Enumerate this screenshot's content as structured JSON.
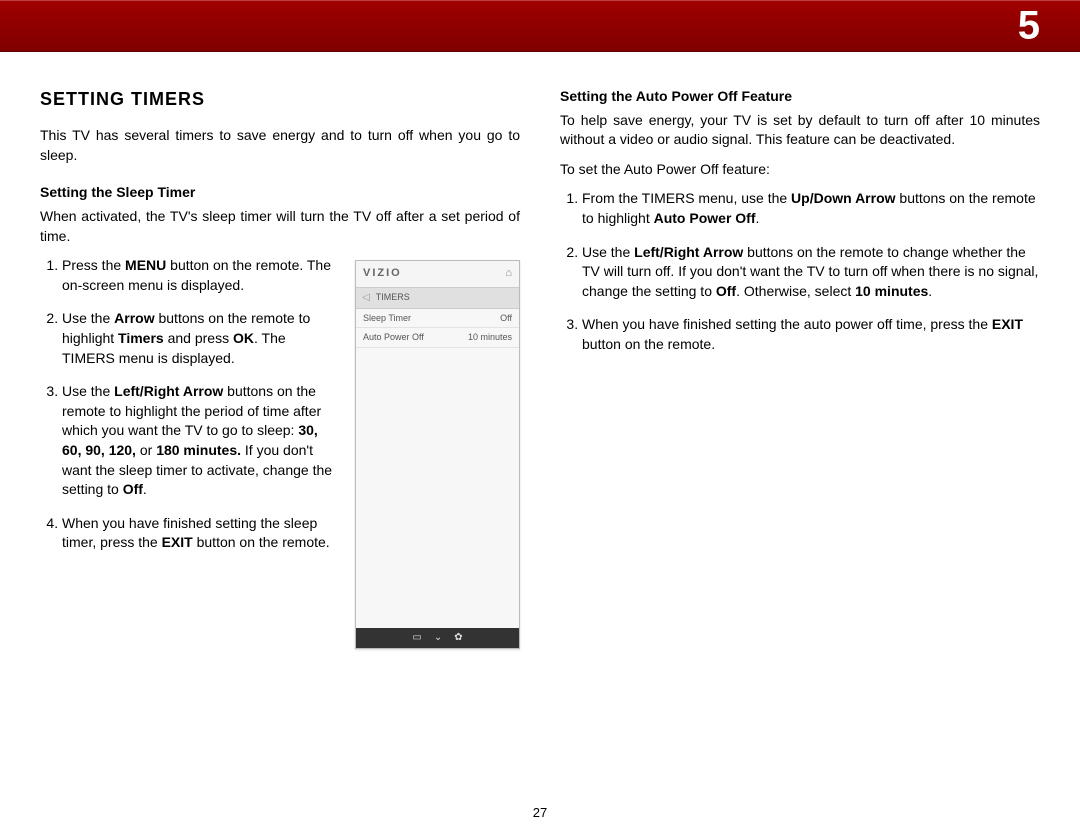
{
  "chapter": "5",
  "page_number": "27",
  "left": {
    "title": "SETTING TIMERS",
    "intro": "This TV has several timers to save energy and to turn off when you go to sleep.",
    "sleep_heading": "Setting the Sleep Timer",
    "sleep_intro": "When activated, the TV's sleep timer will turn the TV off after a set period of time.",
    "steps": {
      "s1a": "Press the ",
      "s1b": "MENU",
      "s1c": " button on the remote. The on-screen menu is displayed.",
      "s2a": "Use the ",
      "s2b": "Arrow",
      "s2c": " buttons on the remote to highlight ",
      "s2d": "Timers",
      "s2e": " and press ",
      "s2f": "OK",
      "s2g": ". The TIMERS menu is displayed.",
      "s3a": "Use the ",
      "s3b": "Left/Right Arrow",
      "s3c": " buttons on the remote to highlight the period of time after which you want the TV to go to sleep: ",
      "s3d": "30, 60, 90, 120,",
      "s3e": " or ",
      "s3f": "180 minutes.",
      "s3g": " If you don't want the sleep timer to activate, change the setting to ",
      "s3h": "Off",
      "s3i": ".",
      "s4a": "When you have finished setting the sleep timer, press the ",
      "s4b": "EXIT",
      "s4c": " button on the remote."
    }
  },
  "menu": {
    "logo": "VIZIO",
    "crumb": "TIMERS",
    "row1_label": "Sleep Timer",
    "row1_value": "Off",
    "row2_label": "Auto Power Off",
    "row2_value": "10 minutes"
  },
  "right": {
    "heading": "Setting the Auto Power Off Feature",
    "intro": "To help save energy, your TV is set by default to turn off after 10 minutes without a video or audio signal. This feature can be deactivated.",
    "lead": "To set the Auto Power Off feature:",
    "steps": {
      "s1a": "From the TIMERS menu, use the ",
      "s1b": "Up/Down Arrow",
      "s1c": " buttons on the remote to highlight ",
      "s1d": "Auto Power Off",
      "s1e": ".",
      "s2a": "Use the ",
      "s2b": "Left/Right Arrow",
      "s2c": " buttons on the remote to change whether the TV will turn off. If you don't want the TV to turn off when there is no signal, change the setting to ",
      "s2d": "Off",
      "s2e": ". Otherwise, select ",
      "s2f": "10 minutes",
      "s2g": ".",
      "s3a": "When you have finished setting the auto power off time, press the ",
      "s3b": "EXIT",
      "s3c": " button on the remote."
    }
  }
}
